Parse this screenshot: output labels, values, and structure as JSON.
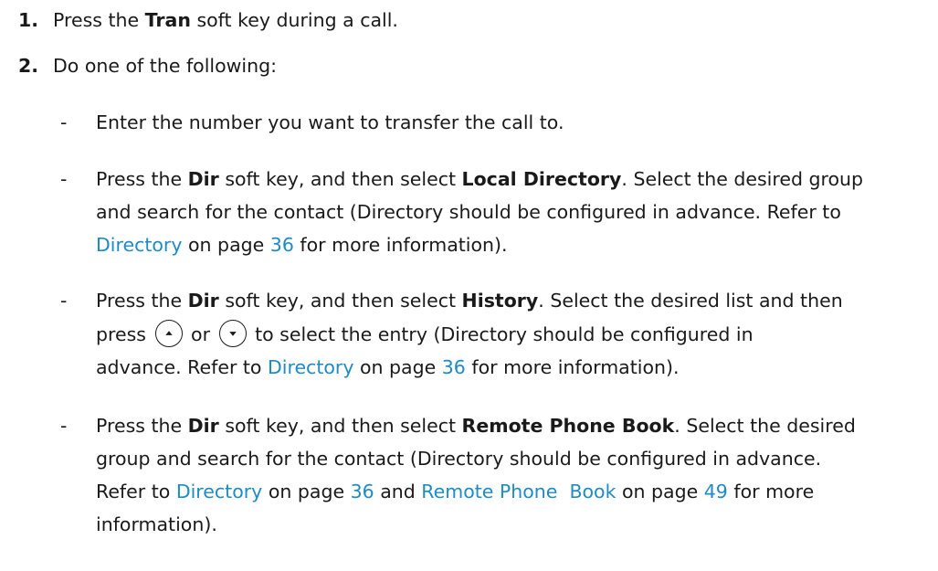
{
  "steps": [
    {
      "number": "1.",
      "pre": "Press the ",
      "bold": "Tran",
      "post": " soft key during a call."
    },
    {
      "number": "2.",
      "text": "Do one of the following:"
    }
  ],
  "options": [
    {
      "dash": "-",
      "line1": "Enter the number you want to transfer the call to."
    },
    {
      "dash": "-",
      "l1_pre": "Press the ",
      "l1_b1": "Dir",
      "l1_mid": " soft key, and then select ",
      "l1_b2": "Local Directory",
      "l1_post": ". Select the desired group",
      "line2": "and search for the contact (Directory should be configured in advance. Refer to",
      "l3_link": "Directory",
      "l3_mid": " on page ",
      "l3_page": "36",
      "l3_post": " for more information)."
    },
    {
      "dash": "-",
      "l1_pre": "Press the ",
      "l1_b1": "Dir",
      "l1_mid": " soft key, and then select ",
      "l1_b2": "History",
      "l1_post": ". Select the desired list and then",
      "l2_pre": "press",
      "l2_or": "or",
      "l2_post": "to select the entry (Directory should be configured in",
      "l3_pre": "advance. Refer to ",
      "l3_link": "Directory",
      "l3_mid": " on page ",
      "l3_page": "36",
      "l3_post": " for more information)."
    },
    {
      "dash": "-",
      "l1_pre": "Press the ",
      "l1_b1": "Dir",
      "l1_mid": " soft key, and then select ",
      "l1_b2": "Remote Phone Book",
      "l1_post": ". Select the desired",
      "line2": "group and search for the contact (Directory should be configured in advance.",
      "l3_pre": "Refer to ",
      "l3_link1": "Directory",
      "l3_mid1": " on page ",
      "l3_page1": "36",
      "l3_and": " and ",
      "l3_link2": "Remote Phone  Book",
      "l3_mid2": " on page ",
      "l3_page2": "49",
      "l3_post": " for more",
      "line4": "information)."
    }
  ],
  "icons": {
    "up": "up-key-icon",
    "down": "down-key-icon"
  },
  "colors": {
    "text": "#1a1a1a",
    "link": "#1e8bc3"
  }
}
